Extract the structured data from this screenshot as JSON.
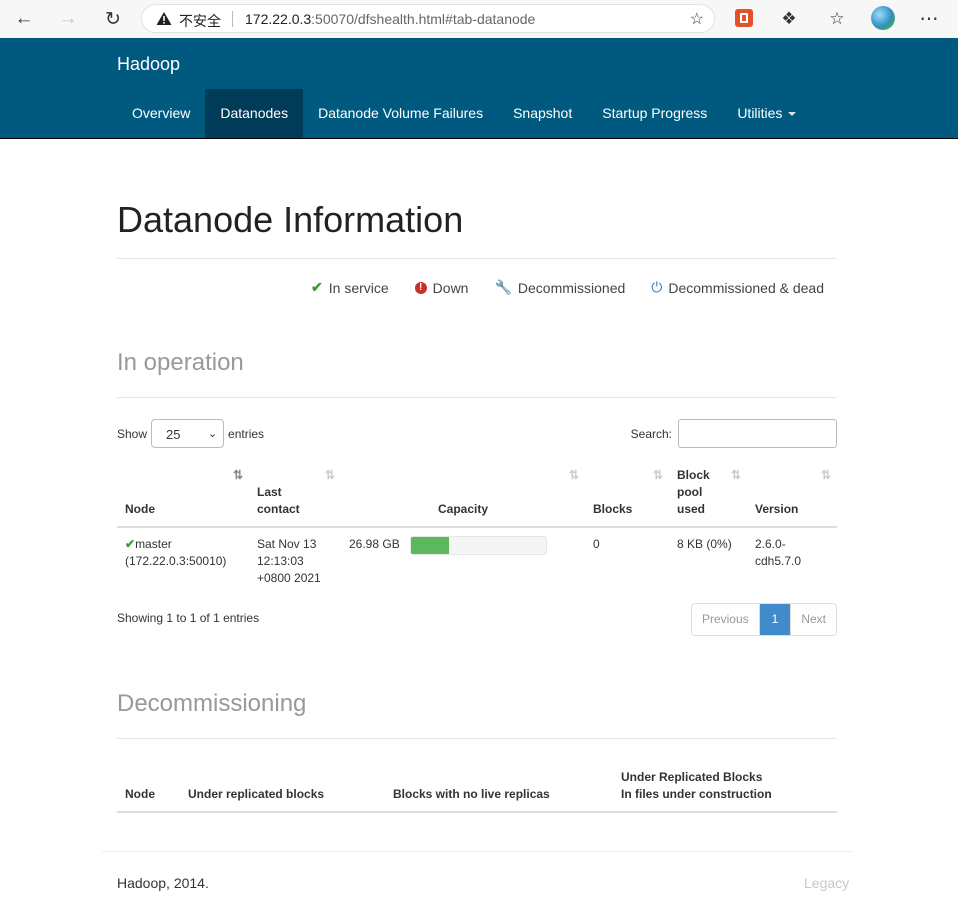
{
  "browser": {
    "insecure_label": "不安全",
    "url_host": "172.22.0.3",
    "url_rest": ":50070/dfshealth.html#tab-datanode"
  },
  "navbar": {
    "brand": "Hadoop",
    "tabs": [
      {
        "label": "Overview"
      },
      {
        "label": "Datanodes"
      },
      {
        "label": "Datanode Volume Failures"
      },
      {
        "label": "Snapshot"
      },
      {
        "label": "Startup Progress"
      },
      {
        "label": "Utilities"
      }
    ]
  },
  "page_title": "Datanode Information",
  "legend": {
    "in_service": "In service",
    "down": "Down",
    "decommissioned": "Decommissioned",
    "decommissioned_dead": "Decommissioned & dead"
  },
  "in_operation": {
    "heading": "In operation",
    "show_label": "Show",
    "page_size": "25",
    "entries_label": "entries",
    "search_label": "Search:",
    "columns": {
      "node": "Node",
      "last_contact_1": "Last",
      "last_contact_2": "contact",
      "capacity": "Capacity",
      "blocks": "Blocks",
      "bpu_1": "Block",
      "bpu_2": "pool",
      "bpu_3": "used",
      "version": "Version"
    },
    "rows": [
      {
        "node_name": "master",
        "node_addr": "(172.22.0.3:50010)",
        "last_contact_1": "Sat Nov 13",
        "last_contact_2": "12:13:03",
        "last_contact_3": "+0800 2021",
        "capacity": "26.98 GB",
        "used_fraction": 0.28,
        "blocks": "0",
        "block_pool_used": "8 KB (0%)",
        "version_1": "2.6.0-",
        "version_2": "cdh5.7.0"
      }
    ],
    "info": "Showing 1 to 1 of 1 entries",
    "pager": {
      "previous": "Previous",
      "current": "1",
      "next": "Next"
    }
  },
  "decommissioning": {
    "heading": "Decommissioning",
    "columns": {
      "node": "Node",
      "under_replicated": "Under replicated blocks",
      "no_live_replicas": "Blocks with no live replicas",
      "urb_1": "Under Replicated Blocks",
      "urb_2": "In files under construction"
    }
  },
  "footer": {
    "text": "Hadoop, 2014.",
    "legacy": "Legacy"
  }
}
